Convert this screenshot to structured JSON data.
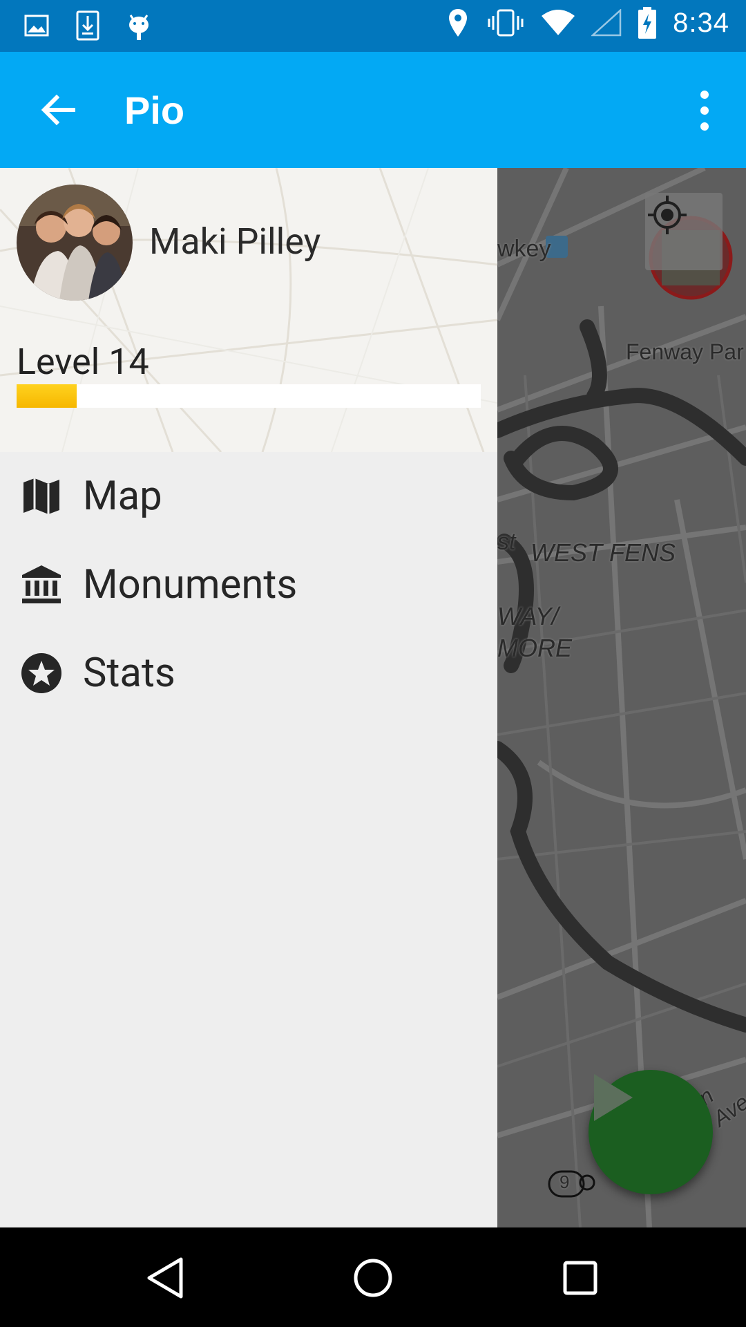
{
  "status_bar": {
    "time": "8:34",
    "left_icons": [
      "image-icon",
      "download-icon",
      "android-icon"
    ],
    "right_icons": [
      "location-icon",
      "vibrate-icon",
      "wifi-icon",
      "signal-icon",
      "battery-charging-icon"
    ]
  },
  "app_bar": {
    "title": "Pio",
    "back_icon": "arrow-back-icon",
    "overflow_icon": "more-vert-icon",
    "color": "#03a9f4"
  },
  "drawer": {
    "user_name": "Maki Pilley",
    "level_label": "Level 14",
    "level_progress_fraction": 0.13,
    "progress_color": "#fbc02d",
    "menu": [
      {
        "label": "Map",
        "icon": "map-icon"
      },
      {
        "label": "Monuments",
        "icon": "monument-icon"
      },
      {
        "label": "Stats",
        "icon": "star-circle-icon"
      }
    ]
  },
  "map": {
    "labels": {
      "wkey": "wkey",
      "fenway_park": "Fenway Par",
      "west_fens": "WEST FENS",
      "st": "st",
      "way": "WAY/",
      "more": "MORE",
      "route": "9",
      "ave": "n Ave"
    },
    "locate_icon": "my-location-icon",
    "fab_icon": "play-icon",
    "fab_color": "#1b5e20"
  },
  "nav_bar": {
    "back_icon": "nav-back-icon",
    "home_icon": "nav-home-icon",
    "recents_icon": "nav-recents-icon"
  }
}
